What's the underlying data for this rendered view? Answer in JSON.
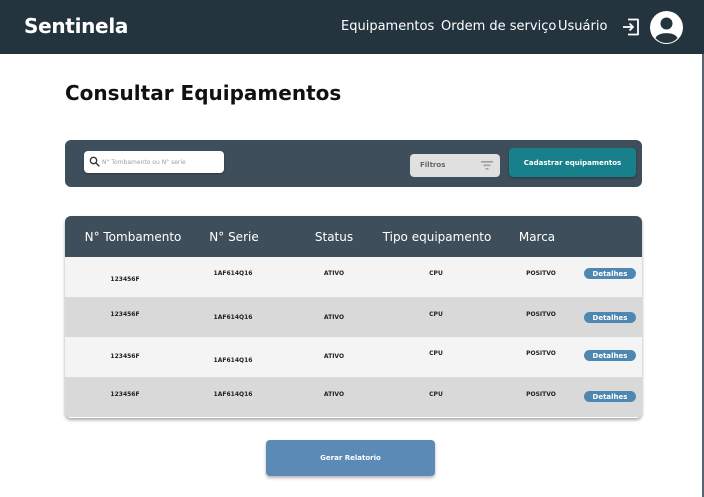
{
  "navbar": {
    "brand": "Sentinela",
    "links": [
      "Equipamentos",
      "Ordem de serviço",
      "Usuário"
    ],
    "logout_icon": "logout-icon",
    "avatar_icon": "user-avatar-icon"
  },
  "page": {
    "title": "Consultar Equipamentos"
  },
  "search": {
    "placeholder": "N° Tombamento ou N° serie",
    "icon": "search-icon",
    "filter_label": "Filtros",
    "filter_icon": "filter-icon",
    "cadastrar_label": "Cadastrar equipamentos"
  },
  "table": {
    "headers": [
      "N° Tombamento",
      "N° Serie",
      "Status",
      "Tipo equipamento",
      "Marca"
    ],
    "rows": [
      {
        "tombamento": "123456F",
        "serie": "1AF614Q16",
        "status": "ATIVO",
        "tipo": "CPU",
        "marca": "POSITVO",
        "action": "Detalhes"
      },
      {
        "tombamento": "123456F",
        "serie": "1AF614Q16",
        "status": "ATIVO",
        "tipo": "CPU",
        "marca": "POSITVO",
        "action": "Detalhes"
      },
      {
        "tombamento": "123456F",
        "serie": "1AF614Q16",
        "status": "ATIVO",
        "tipo": "CPU",
        "marca": "POSITVO",
        "action": "Detalhes"
      },
      {
        "tombamento": "123456F",
        "serie": "1AF614Q16",
        "status": "ATIVO",
        "tipo": "CPU",
        "marca": "POSITVO",
        "action": "Detalhes"
      }
    ]
  },
  "footer": {
    "report_label": "Gerar Relatorio"
  },
  "colors": {
    "navbar": "#24343f",
    "panel": "#3e4f5b",
    "accent_teal": "#17808a",
    "button_blue": "#4f87b3"
  }
}
